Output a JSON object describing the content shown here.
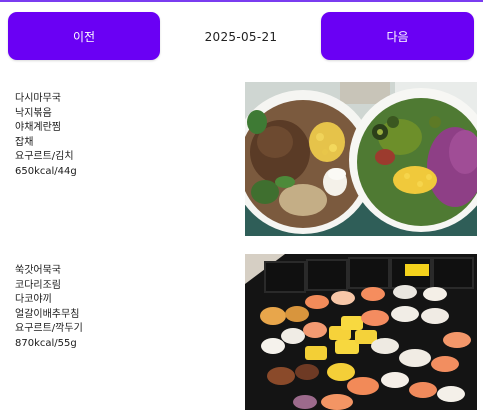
{
  "header": {
    "prev_label": "이전",
    "date": "2025-05-21",
    "next_label": "다음"
  },
  "meals": [
    {
      "items": [
        "다시마무국",
        "낙지볶음",
        "야채계란찜",
        "잡채",
        "요구르트/김치"
      ],
      "nutrition": "650kcal/44g",
      "photo": "salad-bowls-photo"
    },
    {
      "items": [
        "쑥갓어묵국",
        "코다리조림",
        "다코야끼",
        "얼갈이배추무침",
        "요구르트/깍두기"
      ],
      "nutrition": "870kcal/55g",
      "photo": "sushi-platter-photo"
    }
  ],
  "colors": {
    "accent": "#6a00f4",
    "button_text": "#ffffff"
  }
}
